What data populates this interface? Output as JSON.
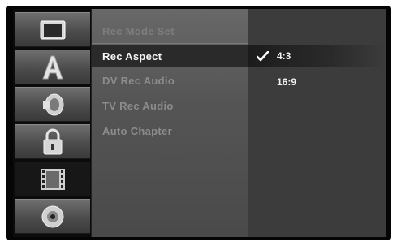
{
  "sidebar": {
    "items": [
      {
        "icon": "tv-screen-icon",
        "active": false
      },
      {
        "icon": "language-a-icon",
        "active": false
      },
      {
        "icon": "speaker-icon",
        "active": false
      },
      {
        "icon": "padlock-icon",
        "active": false
      },
      {
        "icon": "film-strip-icon",
        "active": true
      },
      {
        "icon": "disc-icon",
        "active": false
      }
    ]
  },
  "menu": {
    "items": [
      {
        "label": "Rec Mode Set"
      },
      {
        "label": "Rec Aspect"
      },
      {
        "label": "DV Rec Audio"
      },
      {
        "label": "TV Rec Audio"
      },
      {
        "label": "Auto Chapter"
      }
    ],
    "selected_index": 1
  },
  "options": {
    "items": [
      {
        "label": "4:3",
        "checked": true
      },
      {
        "label": "16:9",
        "checked": false
      }
    ]
  },
  "colors": {
    "background": "#050505",
    "panel": "#555555",
    "highlight": "#2a2a2a",
    "text_active": "#f4f4f4",
    "text_dim": "#8c8c8c"
  }
}
